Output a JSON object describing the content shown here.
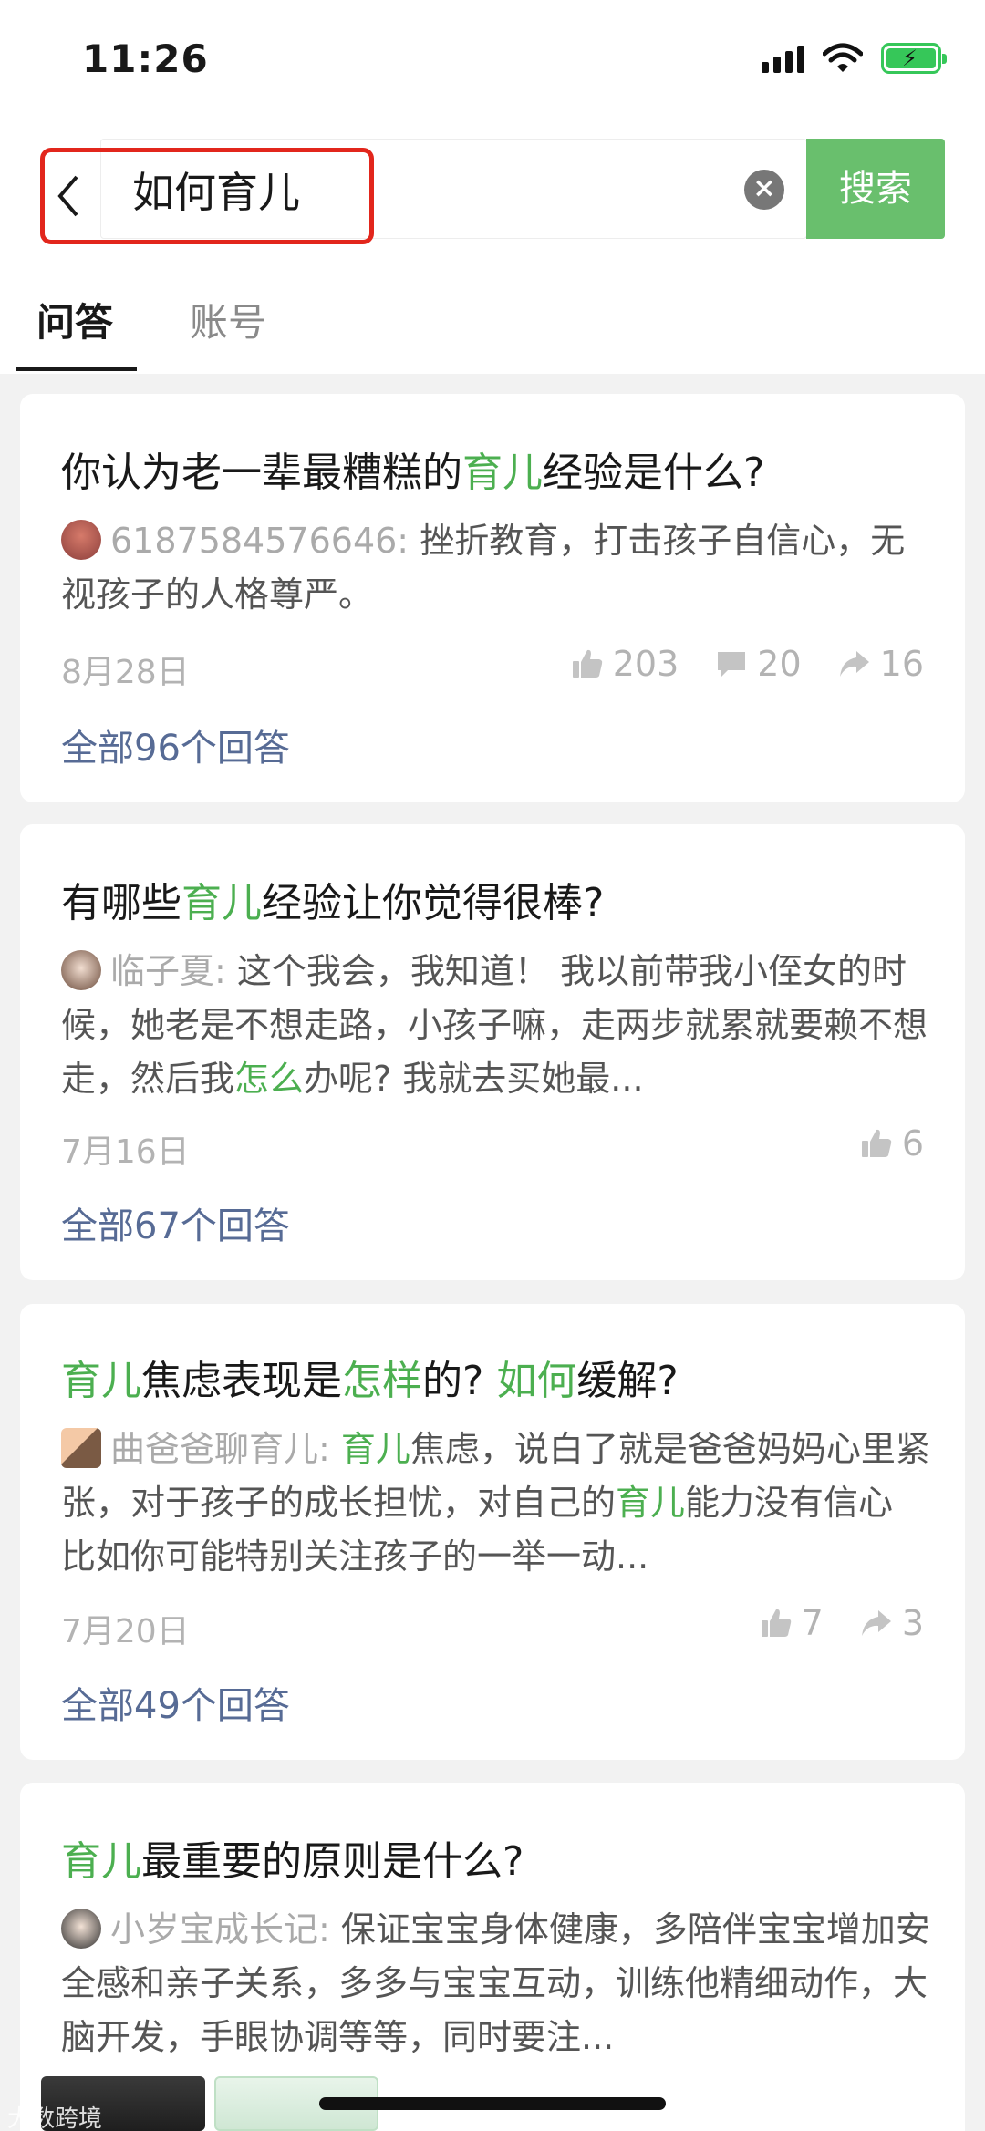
{
  "status": {
    "time": "11:26"
  },
  "search": {
    "query": "如何育儿",
    "button_label": "搜索"
  },
  "tabs": [
    {
      "label": "问答",
      "active": true
    },
    {
      "label": "账号",
      "active": false
    }
  ],
  "colors": {
    "highlight": "#4caf50",
    "search_button": "#69bf6d",
    "link": "#576b95",
    "annotation_box": "#e2261c"
  },
  "questions": [
    {
      "title_parts": [
        "你认为老一辈最糟糕的",
        "育儿",
        "经验是什么?"
      ],
      "author": "6187584576646:",
      "answer_parts": [
        "挫折教育，打击孩子自信心，无视孩子的人格尊严。"
      ],
      "date": "8月28日",
      "likes": "203",
      "comments": "20",
      "shares": "16",
      "all_answers": "全部96个回答"
    },
    {
      "title_parts": [
        "有哪些",
        "育儿",
        "经验让你觉得很棒?"
      ],
      "author": "临子夏:",
      "answer_parts": [
        "这个我会，我知道！ 我以前带我小侄女的时候，她老是不想走路，小孩子嘛，走两步就累就要赖不想走，然后我",
        "怎么",
        "办呢? 我就去买她最..."
      ],
      "date": "7月16日",
      "likes": "6",
      "all_answers": "全部67个回答"
    },
    {
      "title_parts": [
        "育儿",
        "焦虑表现是",
        "怎样",
        "的? ",
        "如何",
        "缓解?"
      ],
      "author": "曲爸爸聊育儿:",
      "answer_parts": [
        "",
        "育儿",
        "焦虑，说白了就是爸爸妈妈心里紧张，对于孩子的成长担忧，对自己的",
        "育儿",
        "能力没有信心 比如你可能特别关注孩子的一举一动..."
      ],
      "date": "7月20日",
      "likes": "7",
      "shares": "3",
      "all_answers": "全部49个回答"
    },
    {
      "title_parts": [
        "育儿",
        "最重要的原则是什么?"
      ],
      "author": "小岁宝成长记:",
      "answer_parts": [
        "保证宝宝身体健康，多陪伴宝宝增加安全感和亲子关系，多多与宝宝互动，训练他精细动作，大脑开发，手眼协调等等，同时要注..."
      ]
    }
  ],
  "watermark": "大数跨境"
}
